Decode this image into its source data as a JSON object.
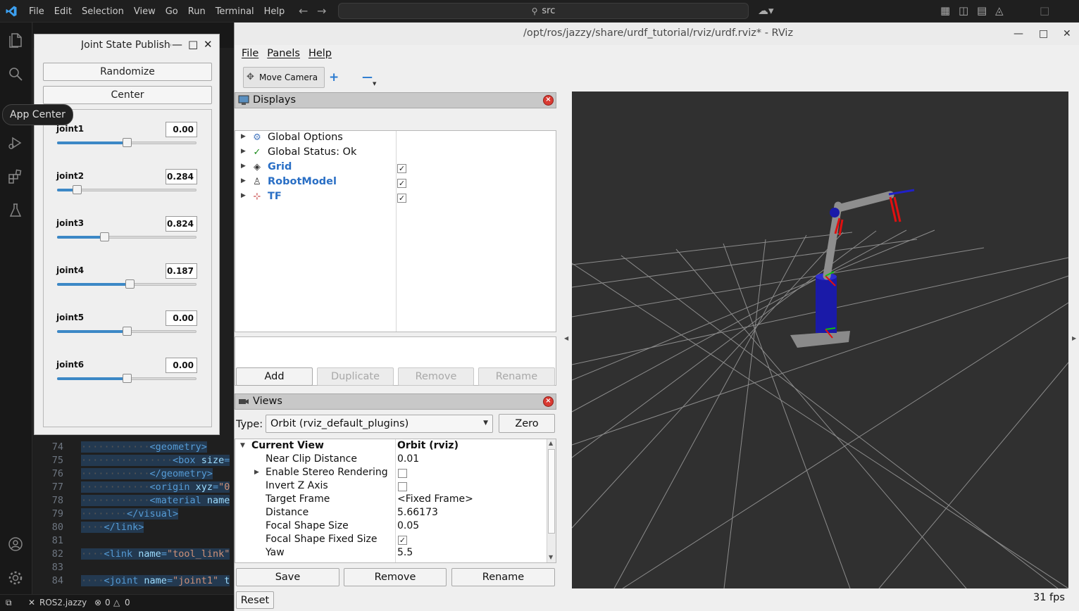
{
  "vscode": {
    "menu": [
      "File",
      "Edit",
      "Selection",
      "View",
      "Go",
      "Run",
      "Terminal",
      "Help"
    ],
    "search_text": "src",
    "tooltip": "App Center",
    "editor_lines": [
      {
        "num": "74",
        "segments": [
          [
            "dt",
            "············"
          ],
          [
            "tg",
            "<geometry>"
          ]
        ]
      },
      {
        "num": "75",
        "segments": [
          [
            "dt",
            "················"
          ],
          [
            "tg",
            "<box "
          ],
          [
            "at",
            "size"
          ],
          [
            "tg",
            "="
          ]
        ]
      },
      {
        "num": "76",
        "segments": [
          [
            "dt",
            "············"
          ],
          [
            "tg",
            "</geometry>"
          ]
        ]
      },
      {
        "num": "77",
        "segments": [
          [
            "dt",
            "············"
          ],
          [
            "tg",
            "<origin "
          ],
          [
            "at",
            "xyz"
          ],
          [
            "tg",
            "="
          ],
          [
            "st",
            "\"0"
          ]
        ]
      },
      {
        "num": "78",
        "segments": [
          [
            "dt",
            "············"
          ],
          [
            "tg",
            "<material "
          ],
          [
            "at",
            "name"
          ]
        ]
      },
      {
        "num": "79",
        "segments": [
          [
            "dt",
            "········"
          ],
          [
            "tg",
            "</visual>"
          ]
        ]
      },
      {
        "num": "80",
        "segments": [
          [
            "dt",
            "····"
          ],
          [
            "tg",
            "</link>"
          ]
        ]
      },
      {
        "num": "81",
        "segments": []
      },
      {
        "num": "82",
        "segments": [
          [
            "dt",
            "····"
          ],
          [
            "tg",
            "<link "
          ],
          [
            "at",
            "name"
          ],
          [
            "tg",
            "="
          ],
          [
            "st",
            "\"tool_link\""
          ]
        ]
      },
      {
        "num": "83",
        "segments": []
      },
      {
        "num": "84",
        "segments": [
          [
            "dt",
            "····"
          ],
          [
            "tg",
            "<joint "
          ],
          [
            "at",
            "name"
          ],
          [
            "tg",
            "="
          ],
          [
            "st",
            "\"joint1\" "
          ],
          [
            "at",
            "t"
          ]
        ]
      }
    ],
    "status": {
      "branch": "ROS2.jazzy",
      "errors": "0",
      "warnings": "0"
    }
  },
  "jsp": {
    "title": "Joint State Publisher",
    "randomize_label": "Randomize",
    "center_label": "Center",
    "joints": [
      {
        "name": "joint1",
        "value": "0.00",
        "position": 0.5
      },
      {
        "name": "joint2",
        "value": "0.284",
        "position": 0.14
      },
      {
        "name": "joint3",
        "value": "0.824",
        "position": 0.34
      },
      {
        "name": "joint4",
        "value": "0.187",
        "position": 0.52
      },
      {
        "name": "joint5",
        "value": "0.00",
        "position": 0.5
      },
      {
        "name": "joint6",
        "value": "0.00",
        "position": 0.5
      }
    ]
  },
  "rviz": {
    "title": "/opt/ros/jazzy/share/urdf_tutorial/rviz/urdf.rviz* - RViz",
    "menu": [
      "File",
      "Panels",
      "Help"
    ],
    "tool_move_camera": "Move Camera",
    "displays": {
      "header": "Displays",
      "items": [
        {
          "name": "Global Options",
          "icon": "gear-icon",
          "bold": false,
          "checked": null
        },
        {
          "name": "Global Status: Ok",
          "icon": "check-icon",
          "bold": false,
          "checked": null
        },
        {
          "name": "Grid",
          "icon": "grid-icon",
          "bold": true,
          "checked": true
        },
        {
          "name": "RobotModel",
          "icon": "robot-icon",
          "bold": true,
          "checked": true
        },
        {
          "name": "TF",
          "icon": "axes-icon",
          "bold": true,
          "checked": true
        }
      ],
      "buttons": {
        "add": "Add",
        "duplicate": "Duplicate",
        "remove": "Remove",
        "rename": "Rename"
      }
    },
    "views": {
      "header": "Views",
      "type_label": "Type:",
      "type_value": "Orbit (rviz_default_plugins)",
      "zero_label": "Zero",
      "current_view_label": "Current View",
      "current_view_value": "Orbit (rviz)",
      "properties": [
        {
          "key": "Near Clip Distance",
          "value": "0.01"
        },
        {
          "key": "Enable Stereo Rendering",
          "value": "",
          "checkbox": false,
          "expandable": true
        },
        {
          "key": "Invert Z Axis",
          "value": "",
          "checkbox": false
        },
        {
          "key": "Target Frame",
          "value": "<Fixed Frame>"
        },
        {
          "key": "Distance",
          "value": "5.66173"
        },
        {
          "key": "Focal Shape Size",
          "value": "0.05"
        },
        {
          "key": "Focal Shape Fixed Size",
          "value": "",
          "checkbox": true
        },
        {
          "key": "Yaw",
          "value": "5.5"
        }
      ],
      "buttons": {
        "save": "Save",
        "remove": "Remove",
        "rename": "Rename"
      }
    },
    "reset_label": "Reset",
    "fps": "31 fps"
  }
}
